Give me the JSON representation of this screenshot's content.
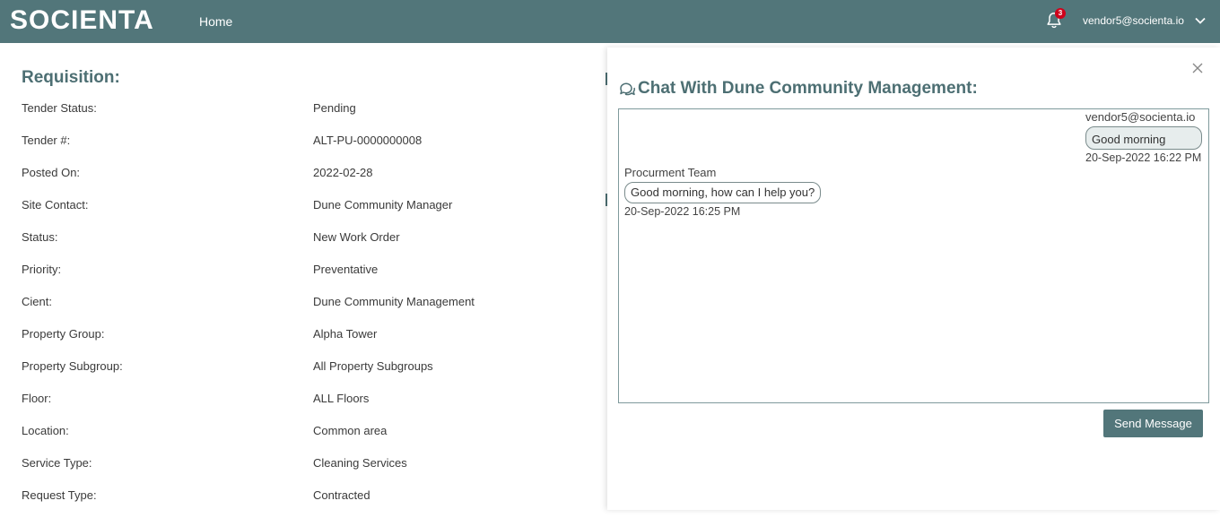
{
  "brand": {
    "logo_text": "SOCIENTA",
    "accent": "#52767a"
  },
  "nav": {
    "home_label": "Home"
  },
  "header": {
    "notification_count": "3",
    "user_email": "vendor5@socienta.io"
  },
  "requisition": {
    "title": "Requisition:",
    "rows": [
      {
        "label": "Tender Status:",
        "value": "Pending"
      },
      {
        "label": "Tender #:",
        "value": "ALT-PU-0000000008"
      },
      {
        "label": "Posted On:",
        "value": "2022-02-28"
      },
      {
        "label": "Site Contact:",
        "value": "Dune Community Manager"
      },
      {
        "label": "Status:",
        "value": "New Work Order"
      },
      {
        "label": "Priority:",
        "value": "Preventative"
      },
      {
        "label": "Cient:",
        "value": "Dune Community Management"
      },
      {
        "label": "Property Group:",
        "value": "Alpha Tower"
      },
      {
        "label": "Property Subgroup:",
        "value": "All Property Subgroups"
      },
      {
        "label": "Floor:",
        "value": "ALL Floors"
      },
      {
        "label": "Location:",
        "value": "Common area"
      },
      {
        "label": "Service Type:",
        "value": "Cleaning Services"
      },
      {
        "label": "Request Type:",
        "value": "Contracted"
      }
    ]
  },
  "chat": {
    "title": "Chat With Dune Community Management:",
    "messages": [
      {
        "sender": "vendor5@socienta.io",
        "text": "Good morning",
        "time": "20-Sep-2022 16:22 PM"
      },
      {
        "sender": "Procurment Team",
        "text": "Good morning, how can I help you?",
        "time": "20-Sep-2022 16:25 PM"
      }
    ],
    "send_label": "Send Message"
  }
}
